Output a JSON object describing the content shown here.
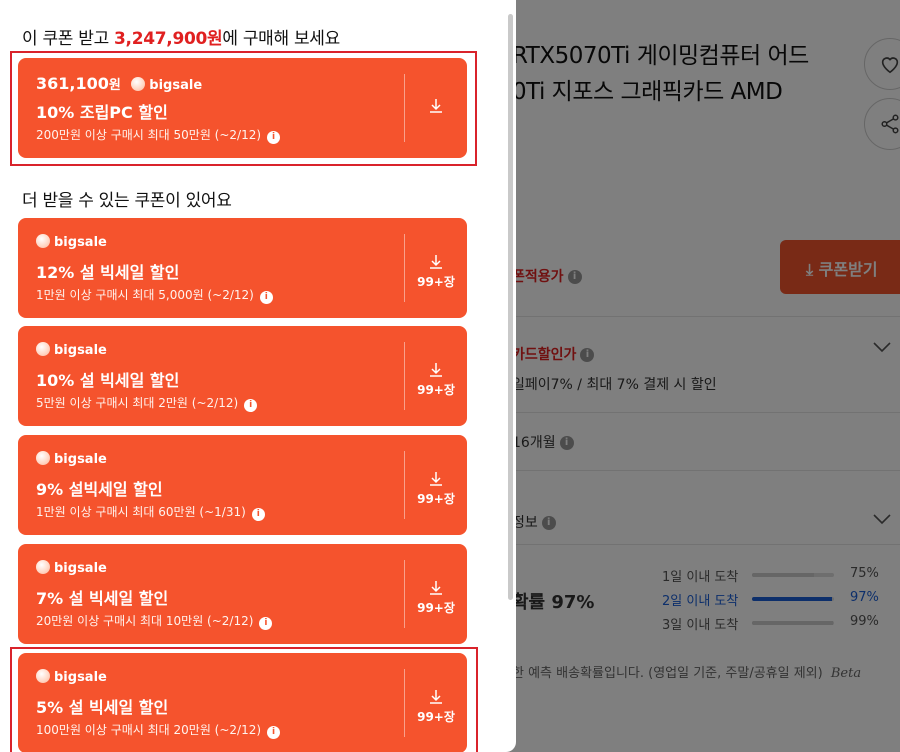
{
  "background_page": {
    "title_line1": "RTX5070Ti 게이밍컴퓨터 어드",
    "title_line2": "0Ti 지포스 그래픽카드 AMD",
    "coupon_button": "쿠폰받기",
    "coupon_applied": "폰적용가",
    "card_discount_label": "카드할인가",
    "card_discount_detail": "일페이7% / 최대 7% 결제 시 할인",
    "installment": "16개월",
    "delivery_label": "정보",
    "delivery_prob_label": "확률 97%",
    "delivery_rows": [
      {
        "label": "1일 이내 도착",
        "percent": "75%",
        "value": 75
      },
      {
        "label": "2일 이내 도착",
        "percent": "97%",
        "value": 97
      },
      {
        "label": "3일 이내 도착",
        "percent": "99%",
        "value": 99
      }
    ],
    "delivery_note": "한 예측 배송확률입니다. (영업일 기준, 주말/공휴일 제외)",
    "beta": "Beta"
  },
  "panel": {
    "head1_prefix": "이 쿠폰 받고 ",
    "head1_price": "3,247,900원",
    "head1_suffix": "에 구매해 보세요",
    "head2": "더 받을 수 있는 쿠폰이 있어요",
    "main_coupon": {
      "amount": "361,100",
      "won": "원",
      "brand": "bigsale",
      "title": "10% 조립PC 할인",
      "condition": "200만원 이상 구매시 최대 50만원 (~2/12)"
    },
    "coupons": [
      {
        "brand": "bigsale",
        "title": "12% 설 빅세일 할인",
        "condition": "1만원 이상 구매시 최대 5,000원 (~2/12)",
        "qty": "99+장"
      },
      {
        "brand": "bigsale",
        "title": "10% 설 빅세일 할인",
        "condition": "5만원 이상 구매시 최대 2만원 (~2/12)",
        "qty": "99+장"
      },
      {
        "brand": "bigsale",
        "title": "9% 설빅세일 할인",
        "condition": "1만원 이상 구매시 최대 60만원 (~1/31)",
        "qty": "99+장"
      },
      {
        "brand": "bigsale",
        "title": "7% 설 빅세일 할인",
        "condition": "20만원 이상 구매시 최대 10만원 (~2/12)",
        "qty": "99+장"
      },
      {
        "brand": "bigsale",
        "title": "5% 설 빅세일 할인",
        "condition": "100만원 이상 구매시 최대 20만원 (~2/12)",
        "qty": "99+장"
      }
    ]
  },
  "colors": {
    "coupon_bg": "#f5532d",
    "accent_red": "#e02020",
    "highlight_border": "#d9232b",
    "delivery_blue": "#1a5fd6"
  },
  "icons": {
    "download": "download-icon",
    "info": "info-icon",
    "heart": "heart-icon",
    "share": "share-icon",
    "chevron": "chevron-down-icon"
  }
}
